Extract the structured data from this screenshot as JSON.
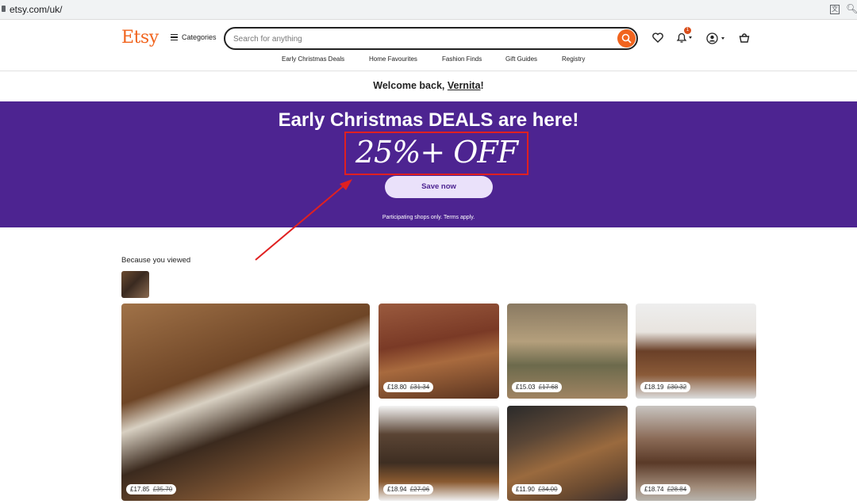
{
  "browser": {
    "url": "etsy.com/uk/",
    "translate_icon": "translate-icon",
    "zoom_icon": "zoom-icon"
  },
  "header": {
    "logo": "Etsy",
    "categories_label": "Categories",
    "search_placeholder": "Search for anything",
    "icons": [
      "search-icon",
      "heart-icon",
      "bell-icon",
      "account-icon",
      "basket-icon"
    ],
    "notification_count": "1",
    "subnav": [
      "Early Christmas Deals",
      "Home Favourites",
      "Fashion Finds",
      "Gift Guides",
      "Registry"
    ]
  },
  "welcome": {
    "prefix": "Welcome back, ",
    "name": "Vernita",
    "suffix": "!"
  },
  "banner": {
    "title": "Early Christmas DEALS are here!",
    "offer": "25%+ OFF",
    "cta": "Save now",
    "terms": "Participating shops only. Terms apply.",
    "color": "#4d2491"
  },
  "section": {
    "title": "Because you viewed"
  },
  "products": [
    {
      "price": "£17.85",
      "was": "£35.70"
    },
    {
      "price": "£18.80",
      "was": "£31.34"
    },
    {
      "price": "£15.03",
      "was": "£17.68"
    },
    {
      "price": "£18.19",
      "was": "£30.32"
    },
    {
      "price": "£18.94",
      "was": "£27.06"
    },
    {
      "price": "£11.90",
      "was": "£34.00"
    },
    {
      "price": "£18.74",
      "was": "£28.84"
    }
  ],
  "colors": {
    "brand": "#f1641e",
    "annotation": "#e02020"
  }
}
